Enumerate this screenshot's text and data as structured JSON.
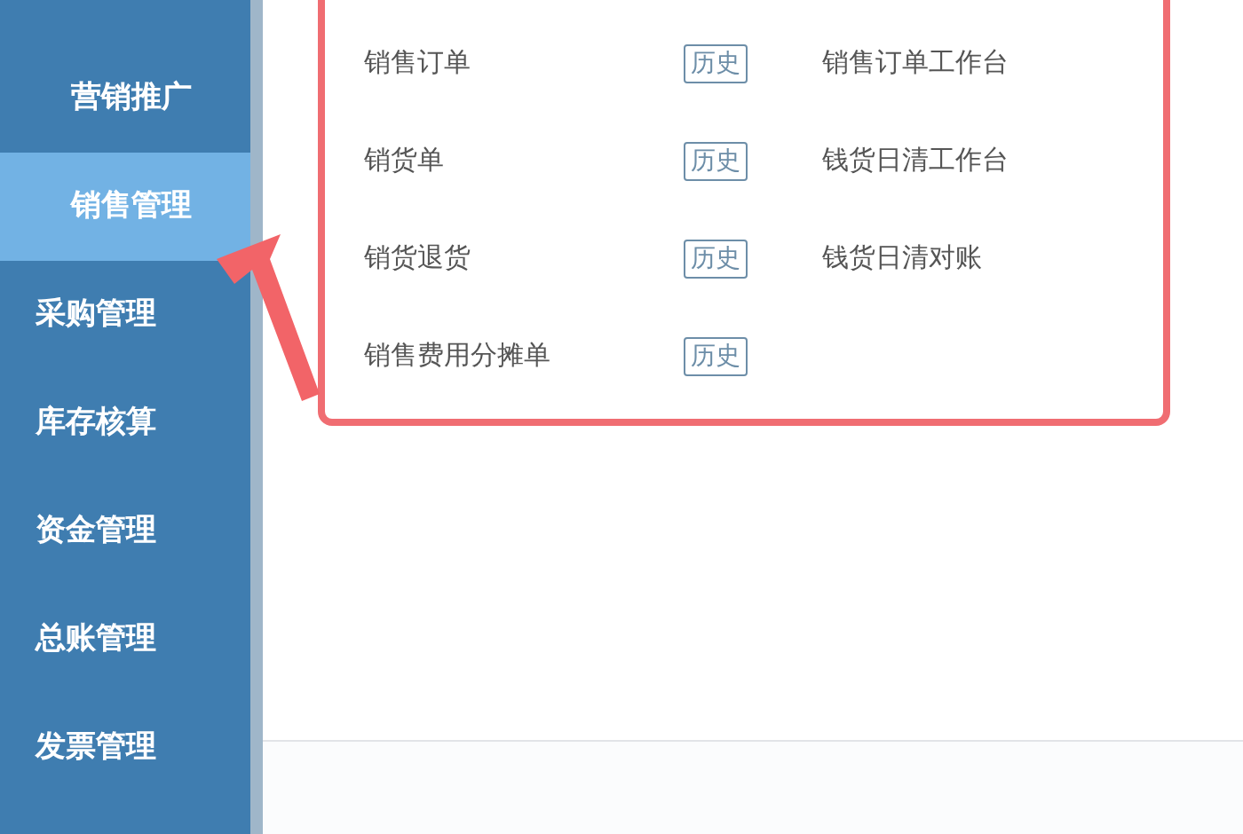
{
  "sidebar": {
    "items": [
      {
        "label": "营销推广",
        "selected": false,
        "kind": "sub"
      },
      {
        "label": "销售管理",
        "selected": true,
        "kind": "sub"
      },
      {
        "label": "采购管理",
        "selected": false,
        "kind": "top"
      },
      {
        "label": "库存核算",
        "selected": false,
        "kind": "top"
      },
      {
        "label": "资金管理",
        "selected": false,
        "kind": "top"
      },
      {
        "label": "总账管理",
        "selected": false,
        "kind": "top"
      },
      {
        "label": "发票管理",
        "selected": false,
        "kind": "top"
      }
    ]
  },
  "menu": {
    "rows": [
      {
        "name": "销售订单",
        "tag": "历史",
        "link": "销售订单工作台"
      },
      {
        "name": "销货单",
        "tag": "历史",
        "link": "钱货日清工作台"
      },
      {
        "name": "销货退货",
        "tag": "历史",
        "link": "钱货日清对账"
      },
      {
        "name": "销售费用分摊单",
        "tag": "历史"
      }
    ]
  }
}
